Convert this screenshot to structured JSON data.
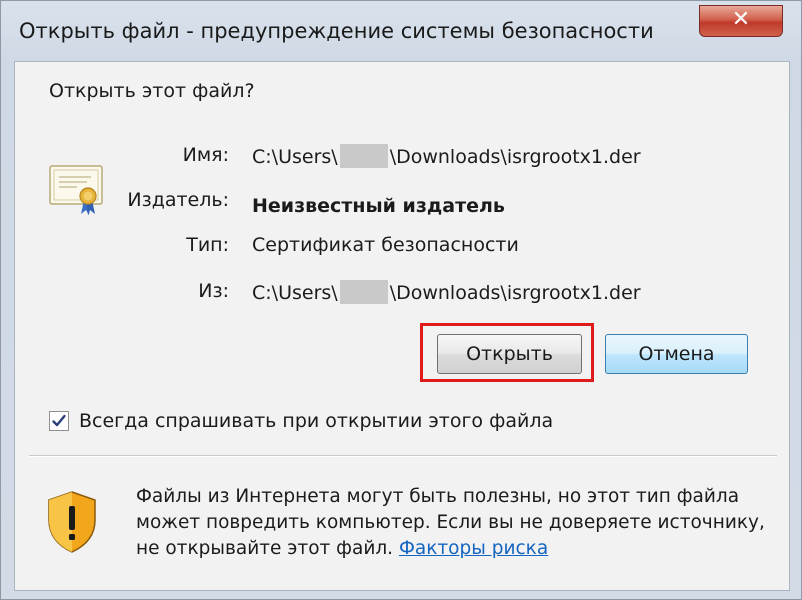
{
  "window": {
    "title": "Открыть файл - предупреждение системы безопасности",
    "close_symbol": "✕"
  },
  "dialog": {
    "question": "Открыть этот файл?",
    "fields": {
      "name_label": "Имя:",
      "name_prefix": "C:\\Users\\",
      "name_suffix": "\\Downloads\\isrgrootx1.der",
      "publisher_label": "Издатель:",
      "publisher_value": "Неизвестный издатель",
      "type_label": "Тип:",
      "type_value": "Сертификат безопасности",
      "from_label": "Из:",
      "from_prefix": "C:\\Users\\",
      "from_suffix": "\\Downloads\\isrgrootx1.der"
    },
    "buttons": {
      "open": "Открыть",
      "cancel": "Отмена"
    },
    "checkbox": {
      "label": "Всегда спрашивать при открытии этого файла",
      "checked": true
    },
    "warning": {
      "text": "Файлы из Интернета могут быть полезны, но этот тип файла может повредить компьютер. Если вы не доверяете источнику, не открывайте этот файл.",
      "link": "Факторы риска"
    }
  },
  "icons": {
    "certificate": "certificate-icon",
    "shield": "shield-warning-icon",
    "checkmark": "checkmark-icon"
  },
  "colors": {
    "highlight": "#e01a1a",
    "link": "#1565c0",
    "close_button": "#c0392b"
  }
}
